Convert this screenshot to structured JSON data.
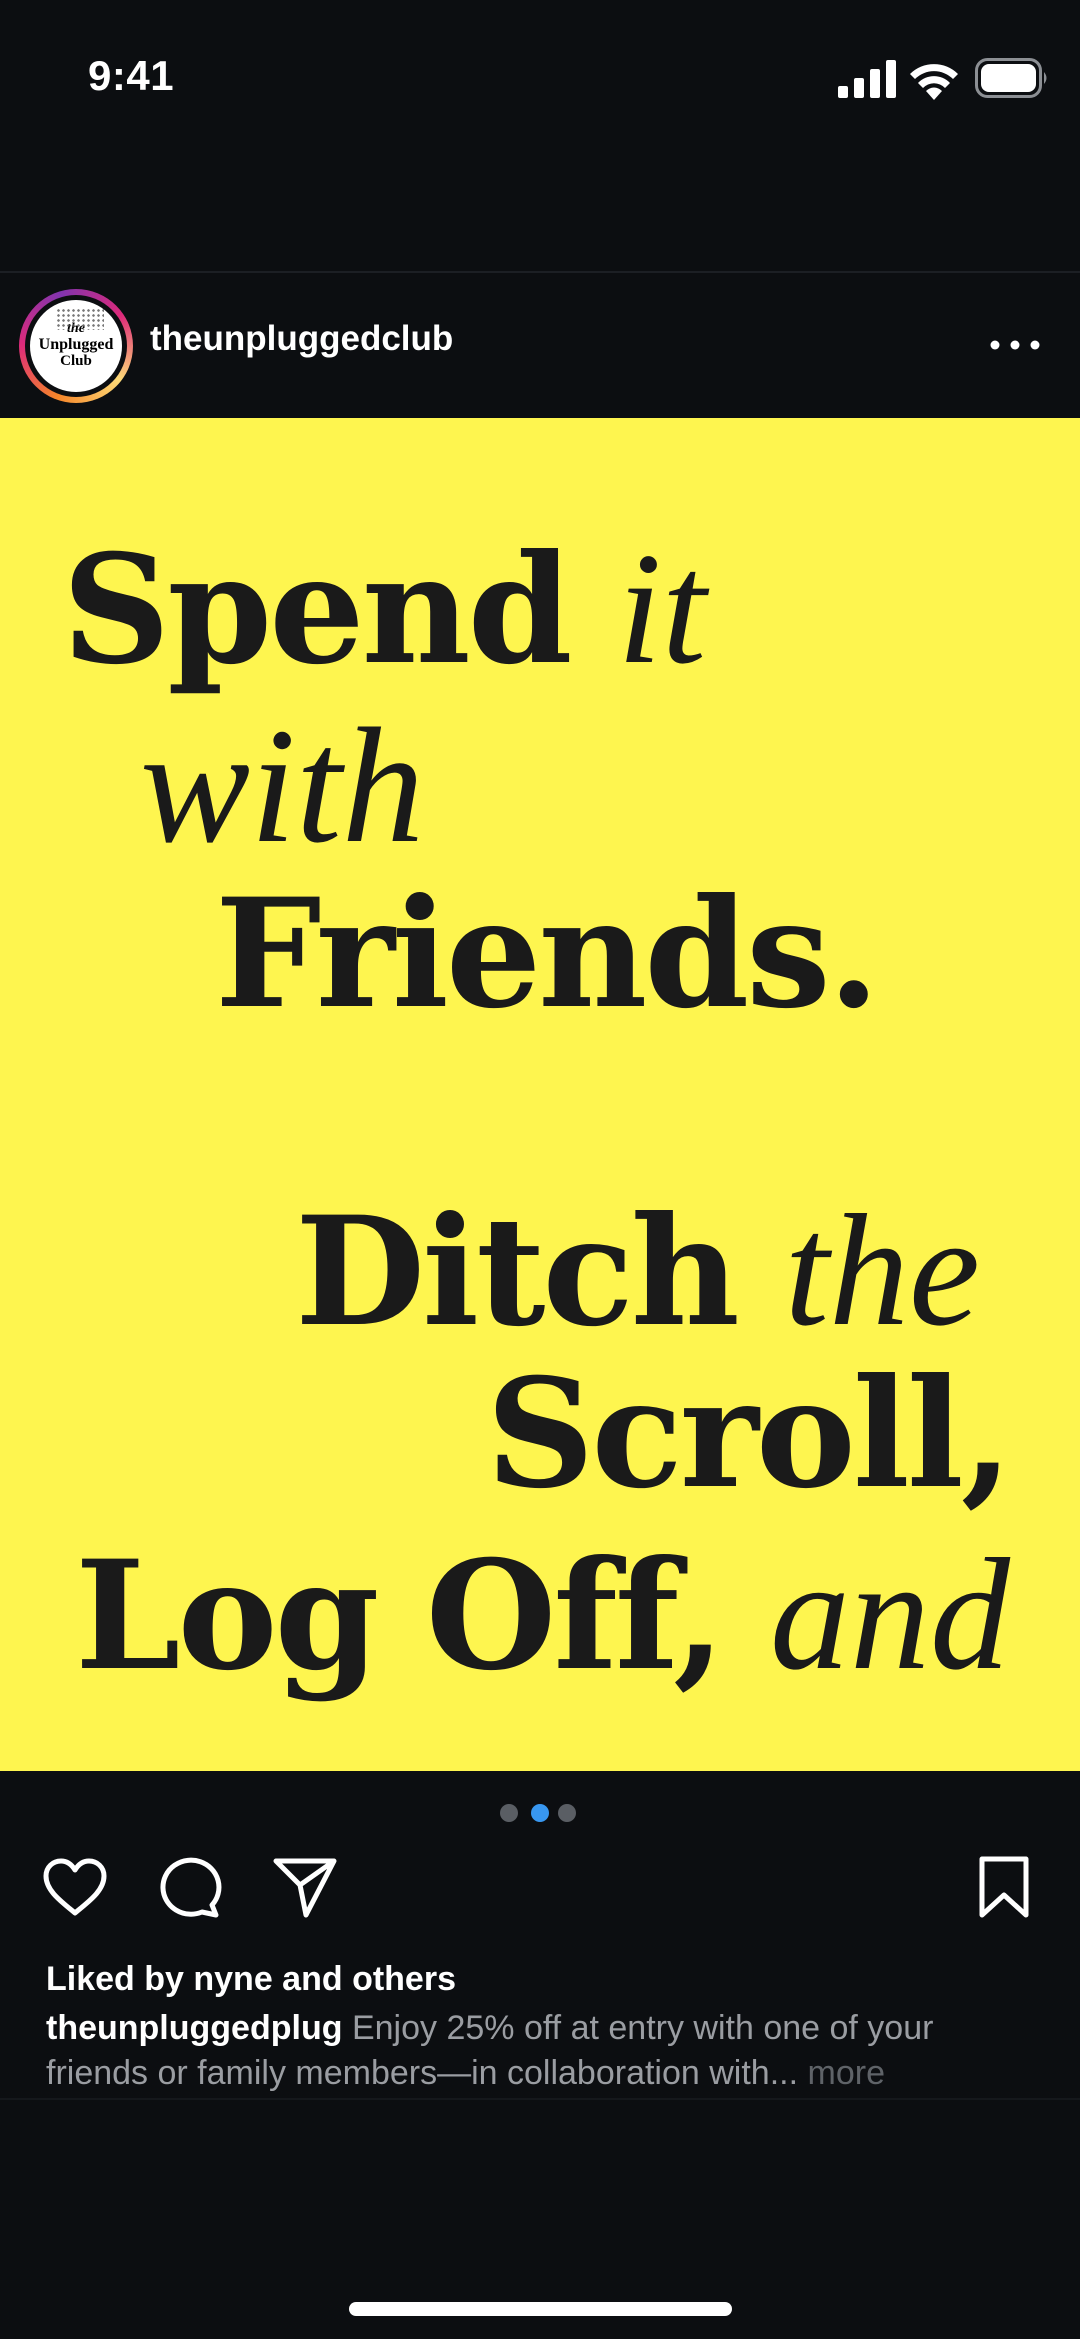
{
  "status_bar": {
    "time": "9:41",
    "icons": [
      "cellular-signal-icon",
      "wifi-icon",
      "battery-icon"
    ]
  },
  "post": {
    "account": {
      "username": "theunpluggedclub",
      "avatar_text": [
        "the",
        "Unplugged",
        "Club"
      ]
    },
    "more_icon": "more-horizontal-icon",
    "image": {
      "background": "#fef54f",
      "text_color": "#1a1a1a",
      "lines": [
        {
          "bold": "Spend",
          "italic": "it"
        },
        {
          "italic": "with"
        },
        {
          "bold": "Friends."
        },
        {
          "bold": "Ditch",
          "italic": "the"
        },
        {
          "bold": "Scroll,"
        },
        {
          "bold": "Log Off,",
          "italic": "and"
        }
      ]
    },
    "carousel": {
      "total": 3,
      "active_index": 1,
      "active_color": "#3897f0"
    },
    "actions": [
      "heart-icon",
      "comment-icon",
      "share-icon",
      "bookmark-icon"
    ],
    "likes_text": "Liked by nyne and others",
    "caption": {
      "username": "theunpluggedplug",
      "text": "Enjoy 25% off at entry with one of your friends or family members—in collaboration with...",
      "more_label": "more"
    }
  }
}
